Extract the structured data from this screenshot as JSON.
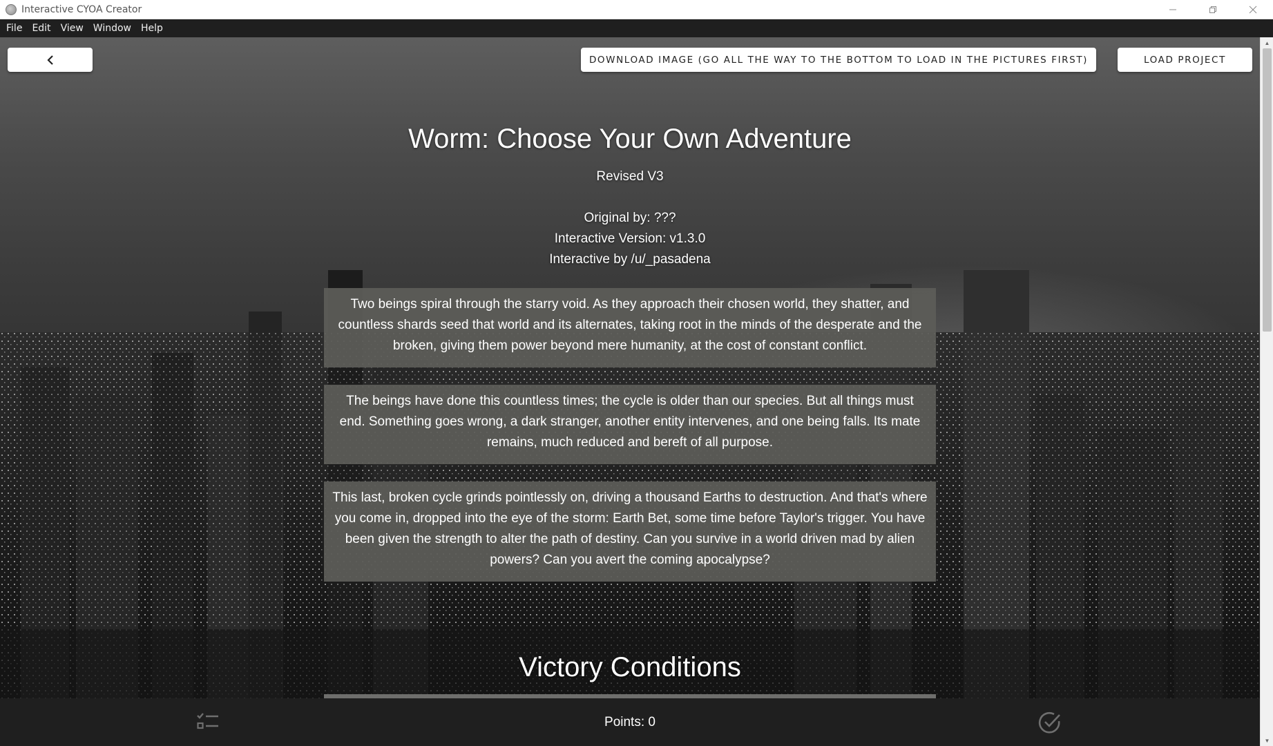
{
  "window": {
    "title": "Interactive CYOA Creator",
    "controls": [
      "minimize-icon",
      "restore-icon",
      "close-icon"
    ]
  },
  "menu": {
    "items": [
      "File",
      "Edit",
      "View",
      "Window",
      "Help"
    ]
  },
  "toolbar": {
    "back_icon": "chevron-left-icon",
    "download_label": "DOWNLOAD IMAGE (GO ALL THE WAY TO THE BOTTOM TO LOAD IN THE PICTURES FIRST)",
    "load_label": "LOAD PROJECT"
  },
  "header": {
    "title": "Worm: Choose Your Own Adventure",
    "subtitle": "Revised V3",
    "credits": [
      "Original by: ???",
      "Interactive Version: v1.3.0",
      "Interactive by /u/_pasadena"
    ]
  },
  "intro": {
    "paragraphs": [
      "Two beings spiral through the starry void. As they approach their chosen world, they shatter, and countless shards seed that world and its alternates, taking root in the minds of the desperate and the broken, giving them power beyond mere humanity, at the cost of constant conflict.",
      "The beings have done this countless times; the cycle is older than our species. But all things must end. Something goes wrong, a dark stranger, another entity intervenes, and one being falls. Its mate remains, much reduced and bereft of all purpose.",
      "This last, broken cycle grinds pointlessly on, driving a thousand Earths to destruction. And that's where you come in, dropped into the eye of the storm: Earth Bet, some time before Taylor's trigger. You have been given the strength to alter the path of destiny. Can you survive in a world driven mad by alien powers? Can you avert the coming apocalypse?"
    ]
  },
  "section": {
    "heading": "Victory Conditions"
  },
  "bottombar": {
    "points_text": "Points: 0",
    "left_icon": "checklist-icon",
    "right_icon": "check-circle-icon"
  },
  "colors": {
    "panel_bg": "#5c5c58",
    "bar_bg": "#1f1f1f",
    "text": "#ffffff"
  }
}
